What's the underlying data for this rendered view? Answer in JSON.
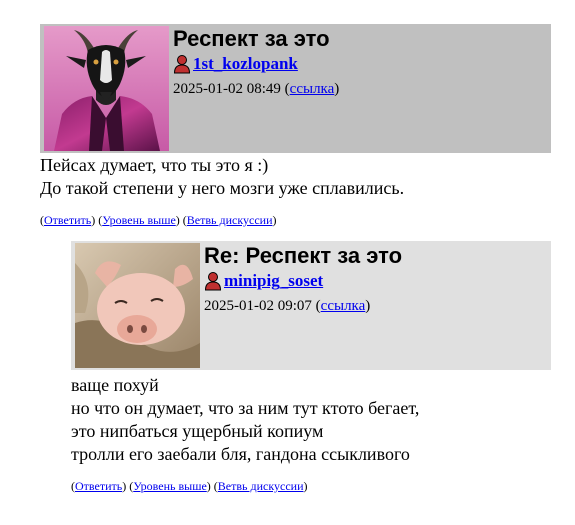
{
  "posts": [
    {
      "title": "Респект за это",
      "author": "1st_kozlopank",
      "datetime": "2025-01-02 08:49",
      "link_label": "ссылка",
      "avatar": "goat-in-leather-jacket-avatar",
      "body_lines": [
        "Пейсах думает, что ты это я :)",
        "До такой степени у него мозги уже сплавились."
      ],
      "actions": [
        "Ответить",
        "Уровень выше",
        "Ветвь дискуссии"
      ]
    },
    {
      "title": "Re: Респект за это",
      "author": "minipig_soset",
      "datetime": "2025-01-02 09:07",
      "link_label": "ссылка",
      "avatar": "piglet-avatar",
      "body_lines": [
        "ваще похуй",
        "но что он думает, что за ним тут ктото бегает,",
        "это нипбаться ущербный копиум",
        "тролли его заебали бля, гандона ссыкливого"
      ],
      "actions": [
        "Ответить",
        "Уровень выше",
        "Ветвь дискуссии"
      ]
    }
  ],
  "colors": {
    "header_top": "#c0c0c0",
    "header_reply": "#e0e0e0",
    "link": "#0000ee"
  }
}
